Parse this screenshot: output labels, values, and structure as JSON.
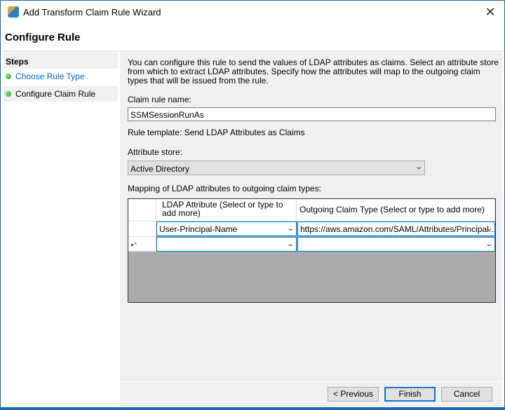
{
  "window": {
    "title": "Add Transform Claim Rule Wizard",
    "close": "✕"
  },
  "header": {
    "title": "Configure Rule"
  },
  "steps": {
    "heading": "Steps",
    "items": [
      {
        "label": "Choose Rule Type",
        "state": "link"
      },
      {
        "label": "Configure Claim Rule",
        "state": "current"
      }
    ]
  },
  "main": {
    "description": "You can configure this rule to send the values of LDAP attributes as claims. Select an attribute store from which to extract LDAP attributes. Specify how the attributes will map to the outgoing claim types that will be issued from the rule.",
    "claim_rule_name_label": "Claim rule name:",
    "claim_rule_name_value": "SSMSessionRunAs",
    "rule_template": "Rule template: Send LDAP Attributes as Claims",
    "attribute_store_label": "Attribute store:",
    "attribute_store_value": "Active Directory",
    "mapping_label": "Mapping of LDAP attributes to outgoing claim types:",
    "grid": {
      "columns": [
        "LDAP Attribute (Select or type to add more)",
        "Outgoing Claim Type (Select or type to add more)"
      ],
      "rows": [
        {
          "ldap": "User-Principal-Name",
          "claim": "https://aws.amazon.com/SAML/Attributes/Principal..."
        }
      ],
      "new_row_marker": "▸*"
    }
  },
  "buttons": {
    "previous": "< Previous",
    "finish": "Finish",
    "cancel": "Cancel"
  },
  "colors": {
    "accent": "#0078d7",
    "link": "#0066cc",
    "border": "#1f63b4"
  }
}
